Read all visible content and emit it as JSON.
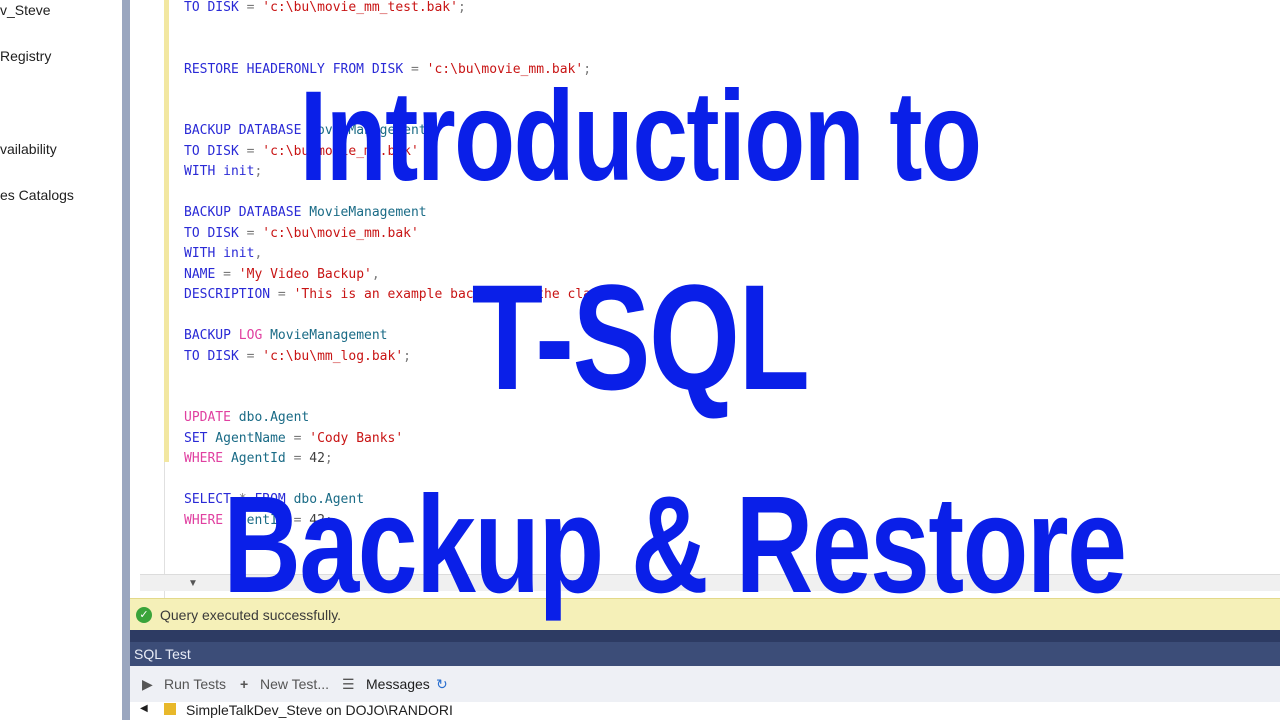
{
  "sidebar": {
    "items": [
      {
        "label": "v_Steve"
      },
      {
        "label": "Registry"
      },
      {
        "label": "vailability"
      },
      {
        "label": "es Catalogs"
      }
    ]
  },
  "editor": {
    "lines": [
      {
        "parts": [
          {
            "t": "TO DISK",
            "c": "kw"
          },
          {
            "t": " = ",
            "c": "gray"
          },
          {
            "t": "'c:\\bu\\movie_mm_test.bak'",
            "c": "str"
          },
          {
            "t": ";",
            "c": "gray"
          }
        ]
      },
      {
        "parts": [
          {
            "t": "RESTORE HEADERONLY FROM DISK",
            "c": "kw"
          },
          {
            "t": " = ",
            "c": "gray"
          },
          {
            "t": "'c:\\bu\\movie_mm.bak'",
            "c": "str"
          },
          {
            "t": ";",
            "c": "gray"
          }
        ]
      },
      {
        "parts": [
          {
            "t": "BACKUP DATABASE",
            "c": "kw"
          },
          {
            "t": " MovieManagement",
            "c": "id"
          }
        ]
      },
      {
        "parts": [
          {
            "t": "TO DISK",
            "c": "kw"
          },
          {
            "t": " = ",
            "c": "gray"
          },
          {
            "t": "'c:\\bu\\movie_mm.bak'",
            "c": "str"
          }
        ]
      },
      {
        "parts": [
          {
            "t": "WITH init",
            "c": "kw"
          },
          {
            "t": ";",
            "c": "gray"
          }
        ]
      },
      {
        "parts": [
          {
            "t": "BACKUP DATABASE",
            "c": "kw"
          },
          {
            "t": " MovieManagement",
            "c": "id"
          }
        ]
      },
      {
        "parts": [
          {
            "t": "TO DISK",
            "c": "kw"
          },
          {
            "t": " = ",
            "c": "gray"
          },
          {
            "t": "'c:\\bu\\movie_mm.bak'",
            "c": "str"
          }
        ]
      },
      {
        "parts": [
          {
            "t": "WITH init",
            "c": "kw"
          },
          {
            "t": ",",
            "c": "gray"
          }
        ]
      },
      {
        "parts": [
          {
            "t": "NAME",
            "c": "kw"
          },
          {
            "t": " = ",
            "c": "gray"
          },
          {
            "t": "'My Video Backup'",
            "c": "str"
          },
          {
            "t": ",",
            "c": "gray"
          }
        ]
      },
      {
        "parts": [
          {
            "t": "DESCRIPTION",
            "c": "kw"
          },
          {
            "t": " = ",
            "c": "gray"
          },
          {
            "t": "'This is an example backup for the class'",
            "c": "str"
          }
        ]
      },
      {
        "parts": [
          {
            "t": "BACKUP ",
            "c": "kw"
          },
          {
            "t": "LOG",
            "c": "pink"
          },
          {
            "t": " MovieManagement",
            "c": "id"
          }
        ]
      },
      {
        "parts": [
          {
            "t": "TO DISK",
            "c": "kw"
          },
          {
            "t": " = ",
            "c": "gray"
          },
          {
            "t": "'c:\\bu\\mm_log.bak'",
            "c": "str"
          },
          {
            "t": ";",
            "c": "gray"
          }
        ]
      },
      {
        "parts": [
          {
            "t": "UPDATE",
            "c": "pink"
          },
          {
            "t": " dbo.Agent",
            "c": "id"
          }
        ]
      },
      {
        "parts": [
          {
            "t": "SET",
            "c": "kw"
          },
          {
            "t": " AgentName",
            "c": "id"
          },
          {
            "t": " = ",
            "c": "gray"
          },
          {
            "t": "'Cody Banks'",
            "c": "str"
          }
        ]
      },
      {
        "parts": [
          {
            "t": "WHERE",
            "c": "pink"
          },
          {
            "t": " AgentId",
            "c": "id"
          },
          {
            "t": " = ",
            "c": "gray"
          },
          {
            "t": "42",
            "c": "plain"
          },
          {
            "t": ";",
            "c": "gray"
          }
        ]
      },
      {
        "parts": [
          {
            "t": "SELECT",
            "c": "kw"
          },
          {
            "t": " * ",
            "c": "gray"
          },
          {
            "t": "FROM",
            "c": "kw"
          },
          {
            "t": " dbo.Agent",
            "c": "id"
          }
        ]
      },
      {
        "parts": [
          {
            "t": "WHERE",
            "c": "pink"
          },
          {
            "t": " AgentId",
            "c": "id"
          },
          {
            "t": " = ",
            "c": "gray"
          },
          {
            "t": "42",
            "c": "plain"
          },
          {
            "t": ";",
            "c": "gray"
          }
        ]
      }
    ]
  },
  "status": {
    "text": "Query executed successfully.",
    "icon": "check-circle-icon",
    "color": "#f5f0b8"
  },
  "sql_test_panel": {
    "title": "SQL Test",
    "toolbar": {
      "run_tests": "Run Tests",
      "new_test": "New Test...",
      "messages": "Messages"
    },
    "tree_item": "SimpleTalkDev_Steve on DOJO\\RANDORI"
  },
  "overlay": {
    "line1": "Introduction to",
    "line2": "T-SQL",
    "line3": "Backup & Restore",
    "color": "#0a1fe8"
  }
}
